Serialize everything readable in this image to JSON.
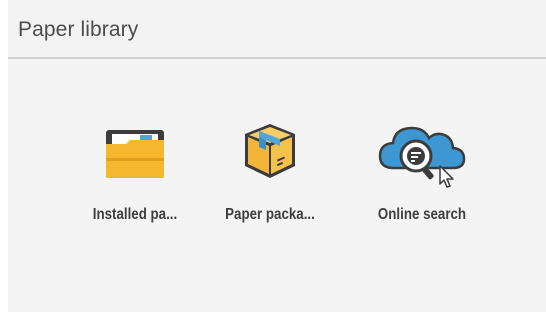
{
  "header": {
    "title": "Paper library"
  },
  "items": [
    {
      "label": "Installed pa...",
      "icon": "folder-icon"
    },
    {
      "label": "Paper packa...",
      "icon": "package-box-icon"
    },
    {
      "label": "Online search",
      "icon": "cloud-search-icon"
    }
  ],
  "colors": {
    "folder": "#f5b72e",
    "folder_dark": "#3c3c3c",
    "box": "#f3b43a",
    "box_tape": "#4fa4d8",
    "cloud": "#3d97d3",
    "background": "#f4f4f4"
  }
}
